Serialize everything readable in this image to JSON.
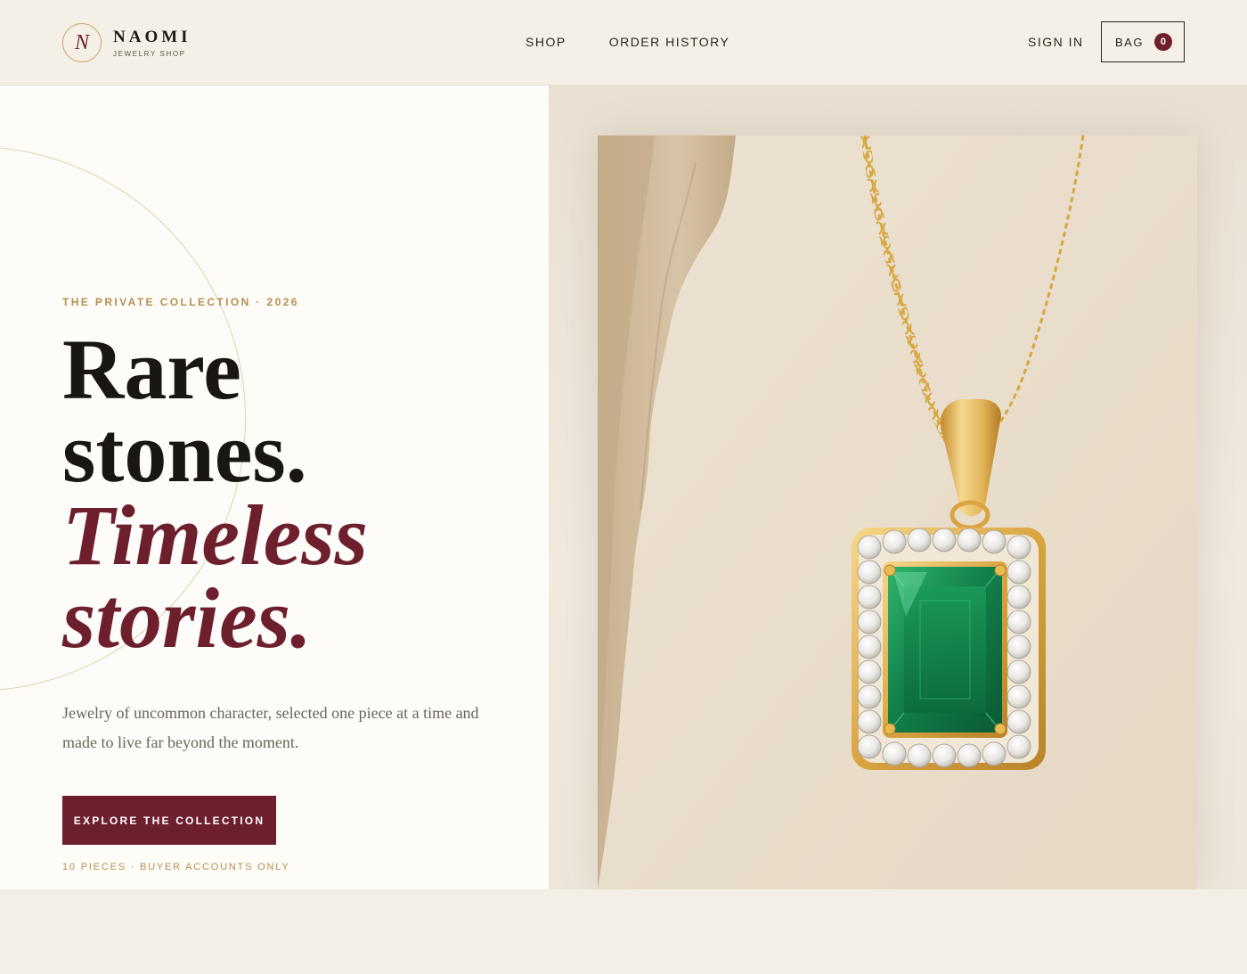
{
  "brand": {
    "monogram": "N",
    "name": "NAOMI",
    "tagline": "JEWELRY SHOP"
  },
  "nav": {
    "shop": "SHOP",
    "order_history": "ORDER HISTORY"
  },
  "account": {
    "sign_in": "SIGN IN",
    "bag_label": "BAG",
    "bag_count": "0"
  },
  "hero": {
    "eyebrow": "THE PRIVATE COLLECTION · 2026",
    "headline_line1": "Rare",
    "headline_line2": "stones.",
    "headline_accent1": "Timeless",
    "headline_accent2": "stories.",
    "lede": "Jewelry of uncommon character, selected one piece at a time and made to live far beyond the moment.",
    "cta_label": "EXPLORE THE COLLECTION",
    "footnote": "10 PIECES · BUYER ACCOUNTS ONLY"
  },
  "colors": {
    "accent": "#6e1f2e",
    "gold": "#b98f52",
    "cream": "#fdfcf8",
    "header_bg": "#f4f0e7",
    "emerald": "#1a8a4e"
  },
  "icons": {
    "monogram": "logo-monogram",
    "photo": "emerald-pendant-photo"
  }
}
